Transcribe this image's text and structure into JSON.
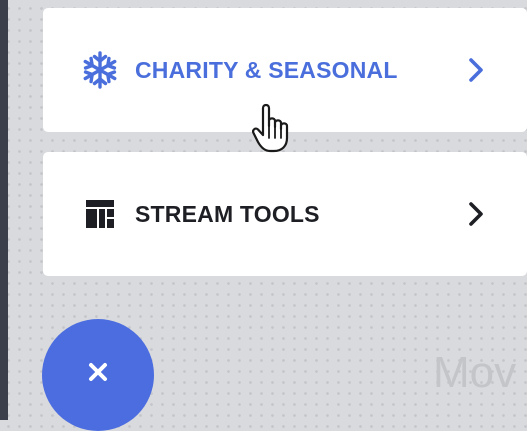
{
  "menu": {
    "items": [
      {
        "label": "CHARITY & SEASONAL",
        "icon": "snowflake-icon",
        "state": "hover"
      },
      {
        "label": "STREAM TOOLS",
        "icon": "dashboard-icon"
      }
    ]
  },
  "fab": {
    "icon": "close-icon"
  },
  "background": {
    "text": "Mov"
  },
  "colors": {
    "accent": "#4a6fdc",
    "fab": "#4b6ddf",
    "text_dark": "#1e1f24",
    "background": "#d9dadd"
  }
}
